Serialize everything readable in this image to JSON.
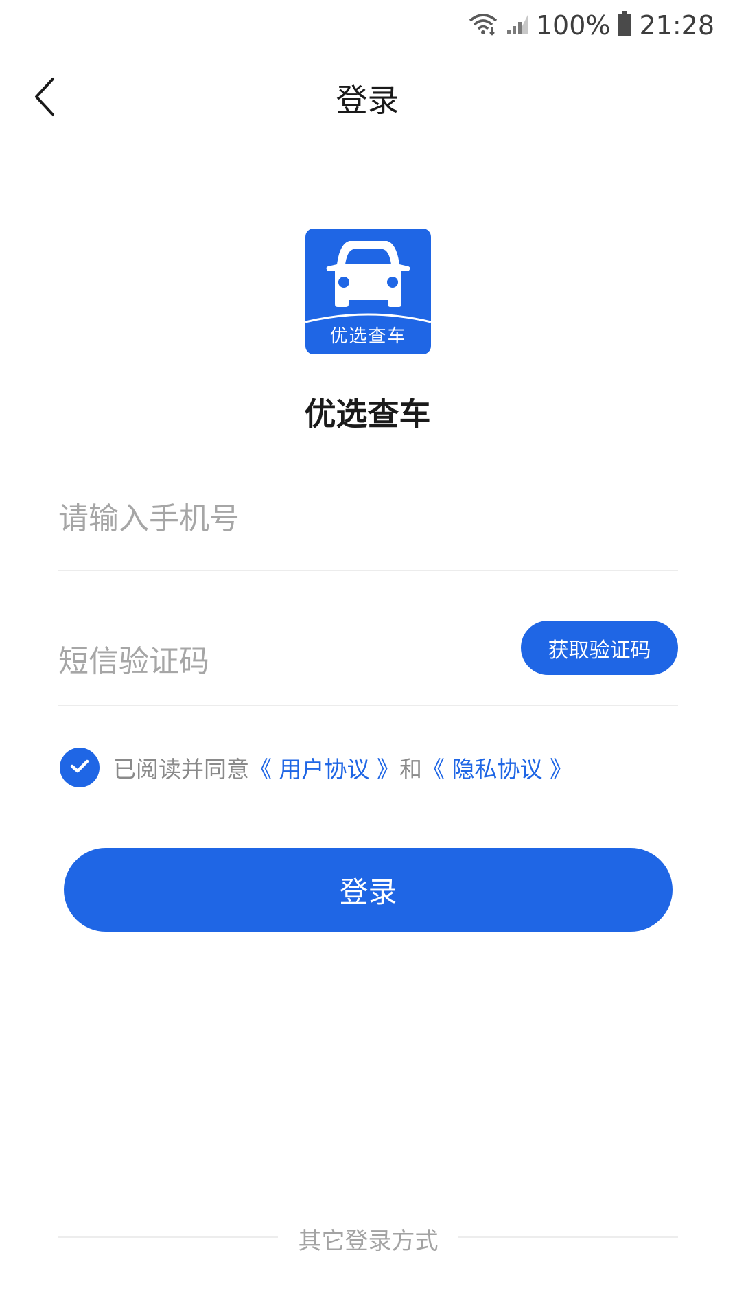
{
  "status_bar": {
    "battery": "100%",
    "time": "21:28"
  },
  "nav": {
    "title": "登录"
  },
  "logo": {
    "text": "优选查车"
  },
  "app_name": "优选查车",
  "phone": {
    "placeholder": "请输入手机号",
    "value": ""
  },
  "code": {
    "placeholder": "短信验证码",
    "value": "",
    "get_code_label": "获取验证码"
  },
  "agreement": {
    "checked": true,
    "prefix": "已阅读并同意",
    "user_agreement": "《 用户协议 》",
    "conjunction": "和",
    "privacy_policy": "《 隐私协议 》"
  },
  "login_button": "登录",
  "other_login": "其它登录方式",
  "colors": {
    "primary": "#1f66e5",
    "placeholder": "#a6a6a6",
    "divider": "#ececec"
  }
}
